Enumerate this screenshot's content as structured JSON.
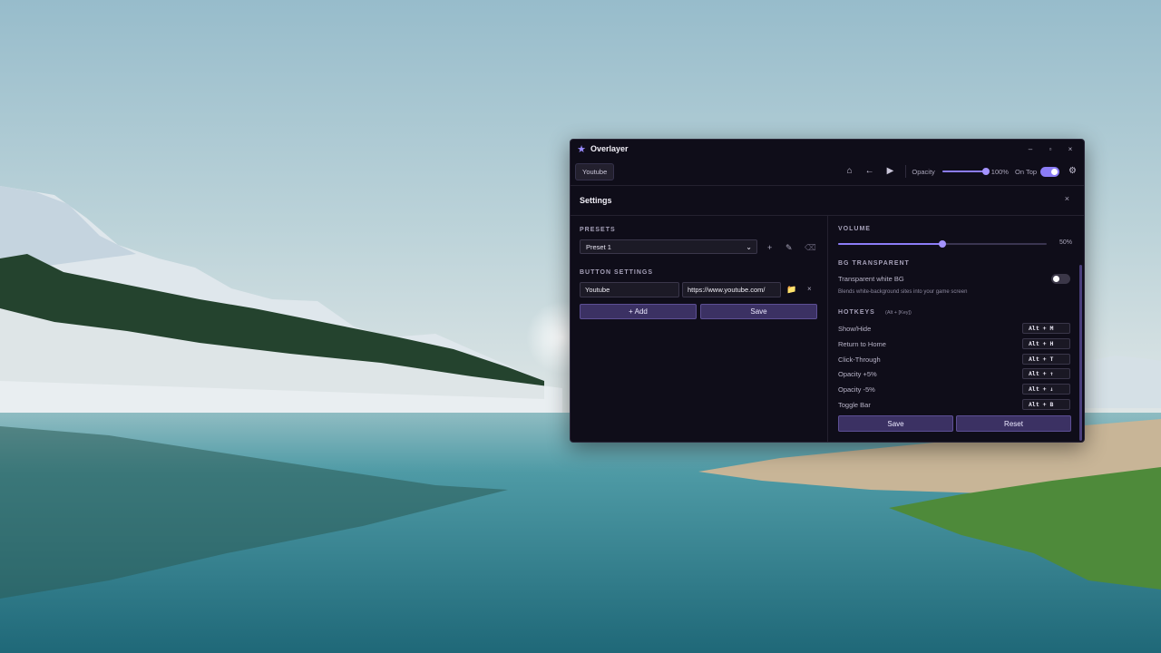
{
  "window": {
    "title": "Overlayer",
    "app_icon": "star-icon"
  },
  "window_controls": {
    "minimize": "–",
    "maximize": "▫",
    "close": "×"
  },
  "toolbar": {
    "tab_label": "Youtube",
    "home_icon": "⌂",
    "back_icon": "←",
    "play_icon": "▶",
    "opacity_label": "Opacity",
    "opacity_value": "100%",
    "opacity_fraction": 1.0,
    "on_top_label": "On Top",
    "on_top_enabled": true,
    "settings_icon": "⚙"
  },
  "settings": {
    "title": "Settings",
    "close": "×",
    "presets": {
      "label": "PRESETS",
      "selected": "Preset 1",
      "add": "+",
      "edit": "✎",
      "delete": "⌫"
    },
    "button_settings": {
      "label": "BUTTON SETTINGS",
      "name_value": "Youtube",
      "url_value": "https://www.youtube.com/",
      "folder_icon": "📁",
      "remove": "×",
      "add_button": "+ Add",
      "save_button": "Save"
    },
    "volume": {
      "label": "VOLUME",
      "value": "50%",
      "fraction": 0.5
    },
    "bg_transparent": {
      "label": "BG TRANSPARENT",
      "option_label": "Transparent white BG",
      "hint": "Blends white-background sites into your game screen",
      "enabled": false
    },
    "hotkeys": {
      "label": "HOTKEYS",
      "sub_label": "(Alt + [Key])",
      "items": [
        {
          "action": "Show/Hide",
          "keys": "Alt + M"
        },
        {
          "action": "Return to Home",
          "keys": "Alt + H"
        },
        {
          "action": "Click-Through",
          "keys": "Alt + T"
        },
        {
          "action": "Opacity +5%",
          "keys": "Alt + ↑"
        },
        {
          "action": "Opacity -5%",
          "keys": "Alt + ↓"
        },
        {
          "action": "Toggle Bar",
          "keys": "Alt + B"
        }
      ],
      "save_button": "Save",
      "reset_button": "Reset"
    }
  },
  "colors": {
    "accent": "#8b7cf6",
    "window_bg": "#0f0d19",
    "button_bg": "#3b3163"
  }
}
